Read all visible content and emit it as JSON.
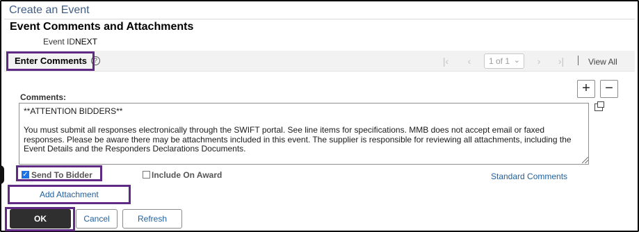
{
  "app": {
    "title": "Create an Event"
  },
  "section": {
    "title": "Event Comments and Attachments"
  },
  "event": {
    "id_label": "Event ID",
    "id_value": "NEXT"
  },
  "grid": {
    "title": "Enter Comments",
    "help_icon_glyph": "?",
    "pager_text": "1 of 1",
    "view_all": "View All",
    "icons": [
      "first-page-icon",
      "previous-icon",
      "next-icon",
      "last-page-icon"
    ]
  },
  "row_actions": {
    "add_glyph": "+",
    "delete_glyph": "−"
  },
  "comments": {
    "label": "Comments:",
    "text": "**ATTENTION BIDDERS**\n\nYou must submit all responses electronically through the SWIFT portal. See line items for specifications. MMB does not accept email or faxed responses. Please be aware there may be attachments included in this event. The supplier is responsible for reviewing all attachments, including the Event Details and the Responders Declarations Documents."
  },
  "options": {
    "send_to_bidder": {
      "label": "Send To Bidder",
      "checked": true
    },
    "include_on_award": {
      "label": "Include On Award",
      "checked": false
    },
    "standard_comments": "Standard Comments",
    "add_attachment": "Add Attachment"
  },
  "buttons": {
    "ok": "OK",
    "cancel": "Cancel",
    "refresh": "Refresh"
  },
  "colors": {
    "highlight": "#5f2a84",
    "link": "#1f5f9e",
    "title": "#3f5d86",
    "primary_button": "#2f2f2f"
  }
}
